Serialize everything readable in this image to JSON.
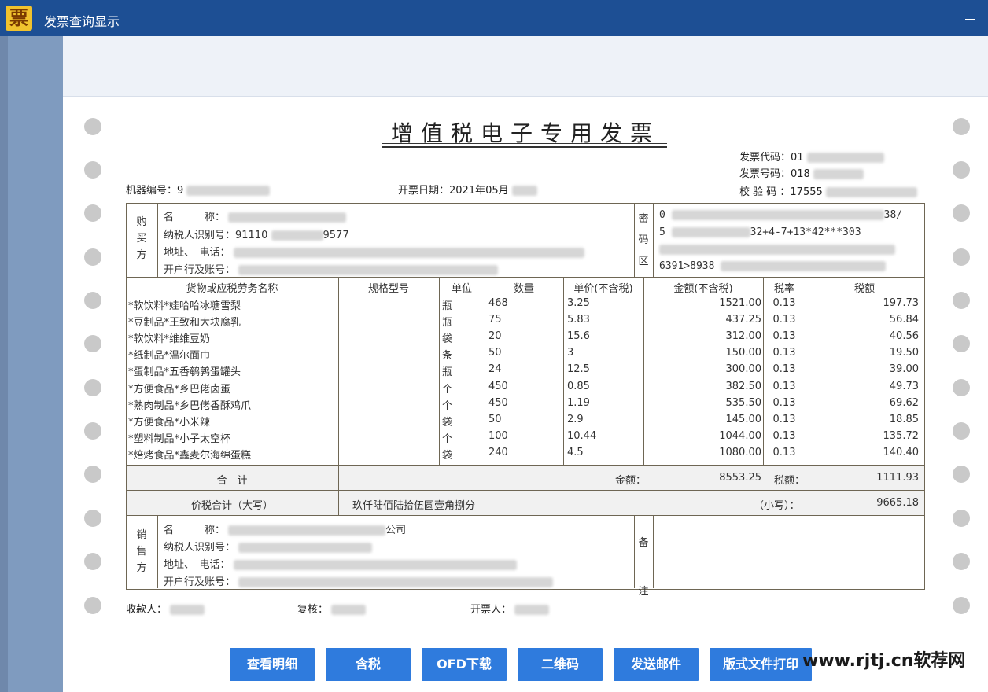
{
  "window": {
    "title": "发票查询显示",
    "logo_char": "票"
  },
  "invoice": {
    "title": "增值税电子专用发票",
    "code_label": "发票代码：",
    "code_value": "01",
    "number_label": "发票号码：",
    "number_value": "018",
    "check_label": "校 验 码 ：",
    "check_value": "17555",
    "machine_label": "机器编号：",
    "machine_value": "9",
    "date_label": "开票日期：",
    "date_value": "2021年05月"
  },
  "buyer": {
    "side_chars": [
      "购",
      "买",
      "方"
    ],
    "name_label": "名　　　称：",
    "tax_id_label": "纳税人识别号：",
    "tax_id_value": "91110",
    "tax_id_tail": "9577",
    "addr_label": "地址、　电话：",
    "bank_label": "开户行及账号："
  },
  "cipher": {
    "side_chars": [
      "密",
      "码",
      "区"
    ],
    "lines": [
      "0",
      "5",
      "6391>8938"
    ],
    "line1_tail": "38/",
    "line2_tail": "32+4-7+13*42***303"
  },
  "table": {
    "headers": [
      "货物或应税劳务名称",
      "规格型号",
      "单位",
      "数量",
      "单价(不含税)",
      "金额(不含税)",
      "税率",
      "税额"
    ],
    "rows": [
      {
        "name": "*软饮料*娃哈哈冰糖雪梨",
        "unit": "瓶",
        "qty": "468",
        "price": "3.25",
        "amount": "1521.00",
        "rate": "0.13",
        "tax": "197.73"
      },
      {
        "name": "*豆制品*王致和大块腐乳",
        "unit": "瓶",
        "qty": "75",
        "price": "5.83",
        "amount": "437.25",
        "rate": "0.13",
        "tax": "56.84"
      },
      {
        "name": "*软饮料*维维豆奶",
        "unit": "袋",
        "qty": "20",
        "price": "15.6",
        "amount": "312.00",
        "rate": "0.13",
        "tax": "40.56"
      },
      {
        "name": "*纸制品*温尔面巾",
        "unit": "条",
        "qty": "50",
        "price": "3",
        "amount": "150.00",
        "rate": "0.13",
        "tax": "19.50"
      },
      {
        "name": "*蛋制品*五香鹌鹑蛋罐头",
        "unit": "瓶",
        "qty": "24",
        "price": "12.5",
        "amount": "300.00",
        "rate": "0.13",
        "tax": "39.00"
      },
      {
        "name": "*方便食品*乡巴佬卤蛋",
        "unit": "个",
        "qty": "450",
        "price": "0.85",
        "amount": "382.50",
        "rate": "0.13",
        "tax": "49.73"
      },
      {
        "name": "*熟肉制品*乡巴佬香酥鸡爪",
        "unit": "个",
        "qty": "450",
        "price": "1.19",
        "amount": "535.50",
        "rate": "0.13",
        "tax": "69.62"
      },
      {
        "name": "*方便食品*小米辣",
        "unit": "袋",
        "qty": "50",
        "price": "2.9",
        "amount": "145.00",
        "rate": "0.13",
        "tax": "18.85"
      },
      {
        "name": "*塑料制品*小子太空杯",
        "unit": "个",
        "qty": "100",
        "price": "10.44",
        "amount": "1044.00",
        "rate": "0.13",
        "tax": "135.72"
      },
      {
        "name": "*焙烤食品*鑫麦尔海绵蛋糕",
        "unit": "袋",
        "qty": "240",
        "price": "4.5",
        "amount": "1080.00",
        "rate": "0.13",
        "tax": "140.40"
      }
    ]
  },
  "totals": {
    "label": "合　计",
    "amount_label": "金额：",
    "amount_value": "8553.25",
    "tax_label": "税额：",
    "tax_value": "1111.93",
    "grand_label": "价税合计（大写）",
    "grand_words": "玖仟陆佰陆拾伍圆壹角捌分",
    "small_label": "（小写）：",
    "grand_value": "9665.18"
  },
  "seller": {
    "side_chars": [
      "销",
      "售",
      "方"
    ],
    "name_label": "名　　　称：",
    "name_tail": "公司",
    "tax_id_label": "纳税人识别号：",
    "addr_label": "地址、　电话：",
    "bank_label": "开户行及账号："
  },
  "remarks": {
    "side_chars": [
      "备",
      "注"
    ]
  },
  "footer": {
    "payee_label": "收款人：",
    "reviewer_label": "复核：",
    "issuer_label": "开票人："
  },
  "buttons": [
    "查看明细",
    "含税",
    "OFD下载",
    "二维码",
    "发送邮件",
    "版式文件打印"
  ],
  "watermark": "www.rjtj.cn软荐网"
}
